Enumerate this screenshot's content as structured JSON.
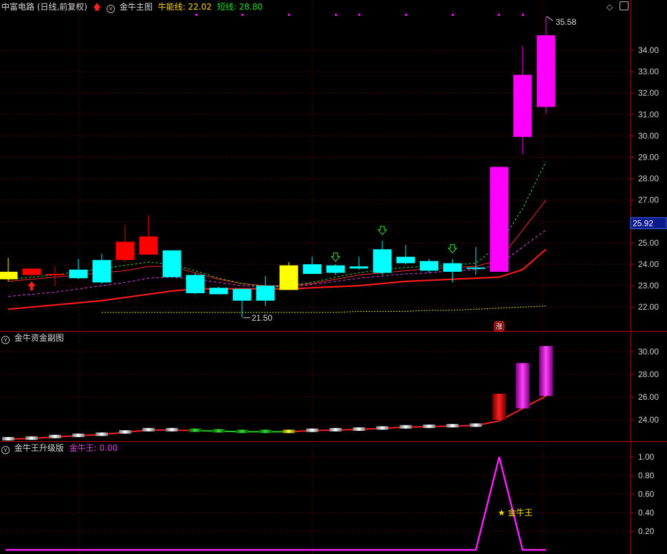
{
  "main": {
    "stock_title": "中富电路 (日线,前复权)",
    "indicator_name": "金牛主图",
    "bull_label": "牛能线:",
    "bull_value": "22.02",
    "short_label": "短线:",
    "short_value": "28.80",
    "current_price_tag": "25.92",
    "high_label": "35.58",
    "low_label": "21.50",
    "limit_badge": "涨",
    "y_ticks": [
      "34.00",
      "33.00",
      "32.00",
      "31.00",
      "30.00",
      "29.00",
      "28.00",
      "27.00",
      "25.00",
      "24.00",
      "23.00",
      "22.00"
    ]
  },
  "sub1": {
    "indicator_name": "金牛资金副图",
    "y_ticks": [
      "30.00",
      "28.00",
      "26.00",
      "24.00"
    ]
  },
  "sub2": {
    "indicator_name": "金牛王升级版",
    "series_label": "金牛王:",
    "series_value": "0.00",
    "annotation": "★ 金牛王",
    "y_ticks": [
      "1.00",
      "0.80",
      "0.60",
      "0.40",
      "0.20"
    ]
  },
  "colors": {
    "up_red": "#ff0000",
    "down_cyan": "#00ffff",
    "limit_magenta": "#ff00ff",
    "neutral_yellow": "#ffff00",
    "axis_red": "#c00000",
    "grid": "#7a0000"
  },
  "icons": {
    "collapse": "chevron-down-in-circle-icon",
    "diamond": "diamond-icon",
    "window": "window-icon",
    "signal": "red-up-arrow-icon"
  },
  "chart_data": {
    "type": "candlestick",
    "price_axis": [
      21.5,
      35.5
    ],
    "candles": [
      {
        "o": 23.3,
        "c": 23.65,
        "h": 24.3,
        "l": 23.2,
        "color": "yellow"
      },
      {
        "o": 23.5,
        "c": 23.8,
        "h": 23.8,
        "l": 23.4,
        "color": "red"
      },
      {
        "o": 23.55,
        "c": 23.55,
        "h": 23.9,
        "l": 23.0,
        "color": "red"
      },
      {
        "o": 23.75,
        "c": 23.35,
        "h": 24.25,
        "l": 23.3,
        "color": "cyan"
      },
      {
        "o": 24.2,
        "c": 23.15,
        "h": 24.5,
        "l": 23.1,
        "color": "cyan"
      },
      {
        "o": 24.2,
        "c": 25.05,
        "h": 25.85,
        "l": 24.1,
        "color": "red"
      },
      {
        "o": 24.45,
        "c": 25.3,
        "h": 26.3,
        "l": 24.45,
        "color": "red"
      },
      {
        "o": 24.65,
        "c": 23.4,
        "h": 24.65,
        "l": 23.4,
        "color": "cyan"
      },
      {
        "o": 23.5,
        "c": 22.65,
        "h": 23.6,
        "l": 22.6,
        "color": "cyan"
      },
      {
        "o": 22.9,
        "c": 22.6,
        "h": 22.95,
        "l": 22.6,
        "color": "cyan"
      },
      {
        "o": 22.85,
        "c": 22.3,
        "h": 22.85,
        "l": 21.5,
        "color": "cyan"
      },
      {
        "o": 22.3,
        "c": 23.0,
        "h": 23.45,
        "l": 22.05,
        "color": "cyan"
      },
      {
        "o": 22.8,
        "c": 23.95,
        "h": 24.1,
        "l": 22.8,
        "color": "yellow"
      },
      {
        "o": 24.0,
        "c": 23.55,
        "h": 24.35,
        "l": 23.55,
        "color": "cyan"
      },
      {
        "o": 23.95,
        "c": 23.6,
        "h": 24.0,
        "l": 23.5,
        "color": "cyan"
      },
      {
        "o": 23.9,
        "c": 23.8,
        "h": 24.35,
        "l": 23.75,
        "color": "cyan"
      },
      {
        "o": 24.7,
        "c": 23.6,
        "h": 25.1,
        "l": 23.5,
        "color": "cyan"
      },
      {
        "o": 24.35,
        "c": 24.05,
        "h": 24.9,
        "l": 24.0,
        "color": "cyan"
      },
      {
        "o": 24.15,
        "c": 23.7,
        "h": 24.25,
        "l": 23.6,
        "color": "cyan"
      },
      {
        "o": 24.05,
        "c": 23.65,
        "h": 24.25,
        "l": 23.15,
        "color": "cyan"
      },
      {
        "o": 23.85,
        "c": 23.8,
        "h": 24.8,
        "l": 23.5,
        "color": "cyan"
      },
      {
        "o": 23.65,
        "c": 28.55,
        "h": 28.55,
        "l": 23.65,
        "color": "magenta"
      },
      {
        "o": 29.95,
        "c": 32.85,
        "h": 34.2,
        "l": 29.15,
        "color": "magenta"
      },
      {
        "o": 31.35,
        "c": 34.7,
        "h": 35.58,
        "l": 31.05,
        "color": "magenta"
      }
    ],
    "series": [
      {
        "values": [
          21.9,
          22.0,
          22.1,
          22.2,
          22.3,
          22.45,
          22.6,
          22.75,
          22.85,
          22.85,
          22.85,
          22.85,
          22.85,
          22.9,
          22.95,
          23.0,
          23.1,
          23.2,
          23.25,
          23.3,
          23.35,
          23.4,
          23.75,
          24.7
        ]
      },
      {
        "values": [
          23.2,
          23.3,
          23.4,
          23.5,
          23.6,
          23.7,
          23.9,
          23.9,
          23.6,
          23.3,
          23.1,
          23.0,
          23.0,
          23.1,
          23.3,
          23.5,
          23.6,
          23.7,
          23.8,
          23.85,
          23.9,
          24.2,
          25.6,
          27.0
        ]
      },
      {
        "values": [
          22.5,
          22.6,
          22.7,
          22.85,
          23.0,
          23.15,
          23.35,
          23.4,
          23.3,
          23.15,
          23.0,
          22.95,
          22.95,
          23.05,
          23.2,
          23.35,
          23.45,
          23.55,
          23.6,
          23.7,
          23.75,
          24.0,
          24.8,
          25.6
        ]
      },
      {
        "values": [
          23.3,
          23.4,
          23.5,
          23.65,
          23.8,
          23.95,
          24.1,
          24.0,
          23.7,
          23.35,
          23.1,
          22.95,
          23.0,
          23.15,
          23.4,
          23.6,
          23.75,
          23.85,
          23.9,
          23.95,
          24.05,
          24.9,
          26.6,
          28.8
        ]
      },
      {
        "values": [
          null,
          null,
          null,
          null,
          21.75,
          21.75,
          21.75,
          21.75,
          21.75,
          21.75,
          21.75,
          21.75,
          21.75,
          21.75,
          21.75,
          21.8,
          21.8,
          21.8,
          21.85,
          21.85,
          21.9,
          21.95,
          22.0,
          22.05
        ]
      }
    ],
    "sub1_axis": [
      22.2,
      31.0
    ],
    "sub1_line": [
      22.3,
      22.35,
      22.5,
      22.6,
      22.7,
      22.9,
      23.1,
      23.1,
      23.05,
      23.0,
      22.95,
      22.95,
      22.95,
      23.05,
      23.1,
      23.15,
      23.25,
      23.35,
      23.4,
      23.45,
      23.5,
      23.9,
      25.0,
      26.1
    ],
    "sub1_bars": [
      null,
      null,
      null,
      null,
      null,
      null,
      null,
      null,
      null,
      null,
      null,
      null,
      null,
      null,
      null,
      null,
      null,
      null,
      null,
      null,
      null,
      [
        24.0,
        26.3
      ],
      [
        25.0,
        29.0
      ],
      [
        26.1,
        30.5
      ]
    ],
    "sub2_axis": [
      0,
      1.05
    ],
    "sub2_line": [
      0,
      0,
      0,
      0,
      0,
      0,
      0,
      0,
      0,
      0,
      0,
      0,
      0,
      0,
      0,
      0,
      0,
      0,
      0,
      0,
      0,
      1,
      0,
      0
    ]
  }
}
